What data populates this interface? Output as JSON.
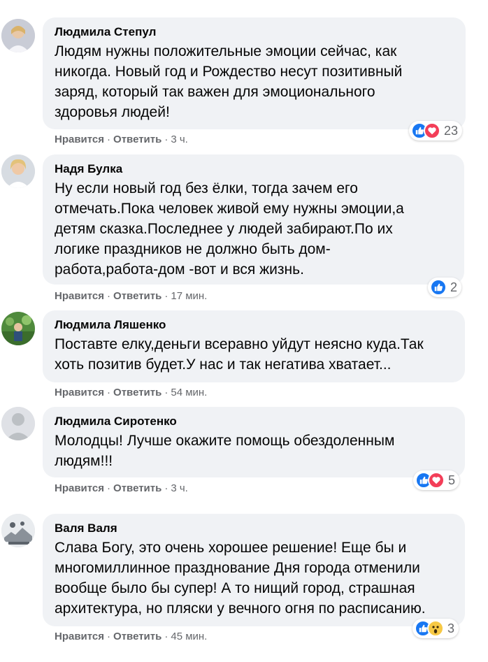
{
  "actions": {
    "like": "Нравится",
    "reply": "Ответить",
    "dot": "·"
  },
  "colors": {
    "bubble": "#f0f2f5",
    "like": "#1877f2",
    "love": "#f33e58",
    "wow": "#f7c945",
    "meta": "#65676b"
  },
  "comments": [
    {
      "author": "Людмила Степул",
      "text": "Людям нужны положительные эмоции сейчас, как\nникогда. Новый год и Рождество несут позитивный\nзаряд, который так важен для эмоционального\nздоровья людей!",
      "time": "3 ч.",
      "reactions": [
        "like-icon",
        "love-icon"
      ],
      "reaction_count": "23"
    },
    {
      "author": "Надя Булка",
      "text": "Ну если новый год без ёлки, тогда зачем его\nотмечать.Пока человек живой ему нужны эмоции,а\nдетям сказка.Последнее у людей забирают.По их\nлогике праздников не должно быть дом-\nработа,работа-дом -вот и вся жизнь.",
      "time": "17 мин.",
      "reactions": [
        "like-icon"
      ],
      "reaction_count": "2"
    },
    {
      "author": "Людмила Ляшенко",
      "text": "Поставте елку,деньги всеравно уйдут неясно куда.Так\nхоть позитив будет.У нас и так негатива хватает...",
      "time": "54 мин.",
      "reactions": [],
      "reaction_count": ""
    },
    {
      "author": "Людмила Сиротенко",
      "text": "Молодцы! Лучше окажите помощь обездоленным\nлюдям!!!",
      "time": "3 ч.",
      "reactions": [
        "like-icon",
        "love-icon"
      ],
      "reaction_count": "5"
    },
    {
      "author": "Валя Валя",
      "text": "Слава Богу, это очень хорошее решение! Еще бы и\nмногомиллинное празднование Дня города отменили\nвообще было бы супер! А то нищий город, страшная\nархитектура, но пляски у вечного огня по расписанию.",
      "time": "45 мин.",
      "reactions": [
        "like-icon",
        "wow-icon"
      ],
      "reaction_count": "3"
    }
  ]
}
